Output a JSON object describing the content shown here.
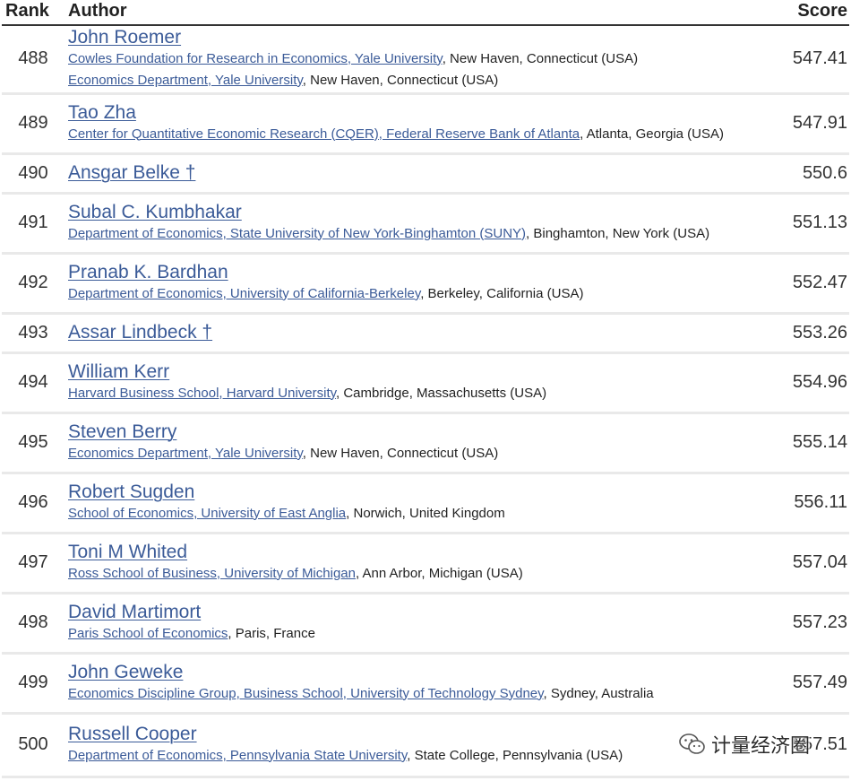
{
  "header": {
    "rank": "Rank",
    "author": "Author",
    "score": "Score"
  },
  "rows": [
    {
      "rank": "488",
      "name": "John Roemer",
      "score": "547.41",
      "affiliations": [
        {
          "link": "Cowles Foundation for Research in Economics, Yale University",
          "location": ", New Haven, Connecticut (USA)"
        },
        {
          "link": "Economics Department, Yale University",
          "location": ", New Haven, Connecticut (USA)"
        }
      ]
    },
    {
      "rank": "489",
      "name": "Tao Zha",
      "score": "547.91",
      "affiliations": [
        {
          "link": "Center for Quantitative Economic Research (CQER), Federal Reserve Bank of Atlanta",
          "location": ", Atlanta, Georgia (USA)"
        }
      ]
    },
    {
      "rank": "490",
      "name": "Ansgar Belke †",
      "score": "550.6",
      "affiliations": []
    },
    {
      "rank": "491",
      "name": "Subal C. Kumbhakar",
      "score": "551.13",
      "affiliations": [
        {
          "link": "Department of Economics, State University of New York-Binghamton (SUNY)",
          "location": ", Binghamton, New York (USA)"
        }
      ]
    },
    {
      "rank": "492",
      "name": "Pranab K. Bardhan",
      "score": "552.47",
      "affiliations": [
        {
          "link": "Department of Economics, University of California-Berkeley",
          "location": ", Berkeley, California (USA)"
        }
      ]
    },
    {
      "rank": "493",
      "name": "Assar Lindbeck †",
      "score": "553.26",
      "affiliations": []
    },
    {
      "rank": "494",
      "name": "William Kerr",
      "score": "554.96",
      "affiliations": [
        {
          "link": "Harvard Business School, Harvard University",
          "location": ", Cambridge, Massachusetts (USA)"
        }
      ]
    },
    {
      "rank": "495",
      "name": "Steven Berry",
      "score": "555.14",
      "affiliations": [
        {
          "link": "Economics Department, Yale University",
          "location": ", New Haven, Connecticut (USA)"
        }
      ]
    },
    {
      "rank": "496",
      "name": "Robert Sugden",
      "score": "556.11",
      "affiliations": [
        {
          "link": "School of Economics, University of East Anglia",
          "location": ", Norwich, United Kingdom"
        }
      ]
    },
    {
      "rank": "497",
      "name": "Toni M Whited",
      "score": "557.04",
      "affiliations": [
        {
          "link": "Ross School of Business, University of Michigan",
          "location": ", Ann Arbor, Michigan (USA)"
        }
      ]
    },
    {
      "rank": "498",
      "name": "David Martimort",
      "score": "557.23",
      "affiliations": [
        {
          "link": "Paris School of Economics",
          "location": ", Paris, France"
        }
      ]
    },
    {
      "rank": "499",
      "name": "John Geweke",
      "score": "557.49",
      "affiliations": [
        {
          "link": "Economics Discipline Group, Business School, University of Technology Sydney",
          "location": ", Sydney, Australia"
        }
      ]
    },
    {
      "rank": "500",
      "name": "Russell Cooper",
      "score": "557.51",
      "affiliations": [
        {
          "link": "Department of Economics, Pennsylvania State University",
          "location": ", State College, Pennsylvania (USA)"
        }
      ]
    }
  ],
  "watermark": {
    "text": "计量经济圈",
    "icon": "wechat-icon"
  }
}
